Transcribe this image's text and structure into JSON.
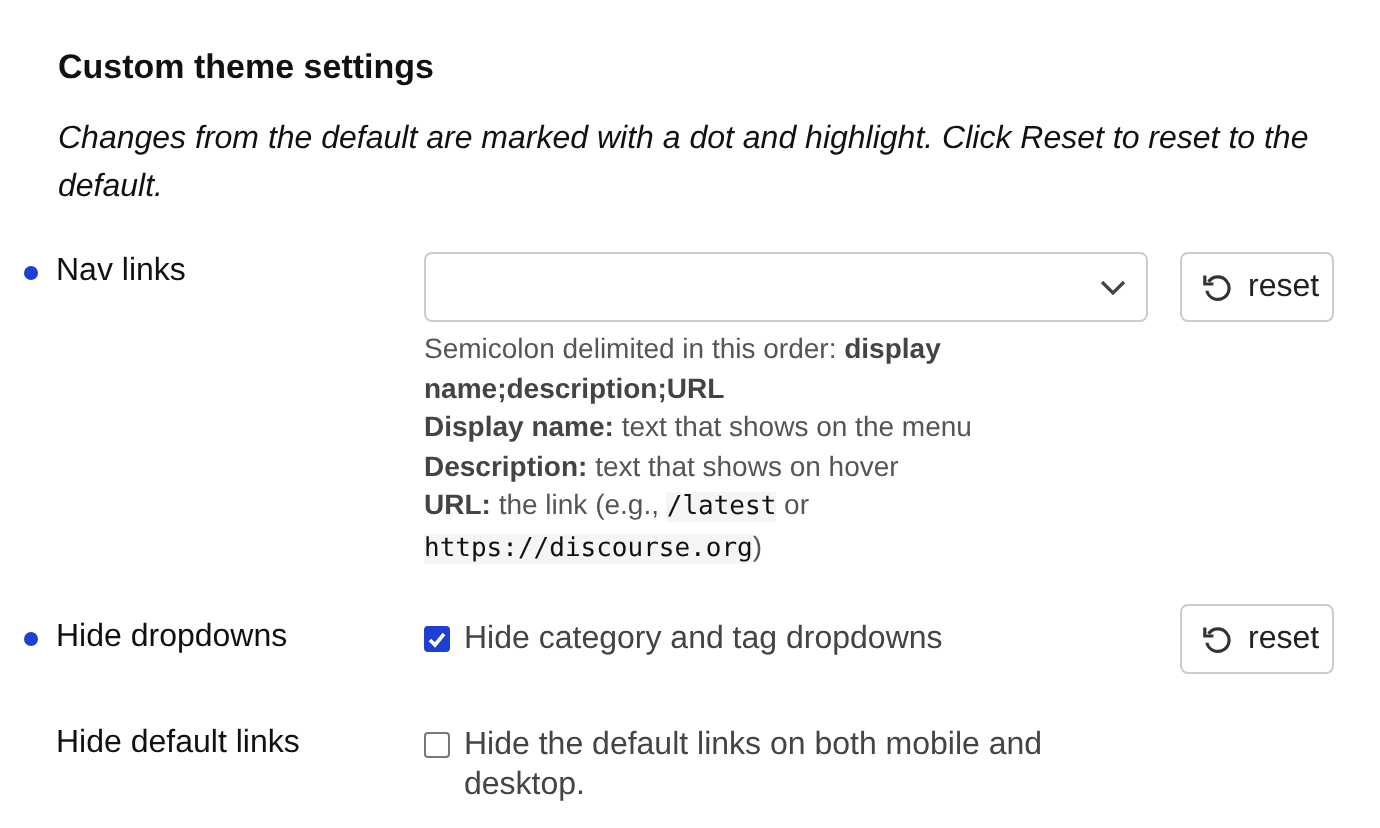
{
  "title": "Custom theme settings",
  "description": "Changes from the default are marked with a dot and highlight. Click Reset to reset to the default.",
  "settings": [
    {
      "kind": "select",
      "label": "Nav links",
      "changed": true,
      "reset": "reset",
      "help": [
        [
          {
            "kind": "text",
            "text": "Semicolon delimited in this order: **display name;description;URL**"
          }
        ],
        [
          {
            "kind": "text",
            "text": "**Display name:** text that shows on the menu"
          }
        ],
        [
          {
            "kind": "text",
            "text": "**Description:** text that shows on hover"
          }
        ],
        [
          {
            "kind": "text",
            "text": "**URL:** the link (e.g., "
          },
          {
            "kind": "code",
            "text": "/latest"
          },
          {
            "kind": "text",
            "text": " or "
          },
          {
            "kind": "code",
            "text": "https://discourse.org"
          },
          {
            "kind": "text",
            "text": ")"
          }
        ]
      ]
    },
    {
      "kind": "checkbox",
      "label": "Hide dropdowns",
      "changed": true,
      "checked": true,
      "text": "Hide category and tag dropdowns",
      "reset": "reset"
    },
    {
      "kind": "checkbox",
      "label": "Hide default links",
      "changed": false,
      "checked": false,
      "text": "Hide the default links on both mobile and desktop."
    }
  ]
}
